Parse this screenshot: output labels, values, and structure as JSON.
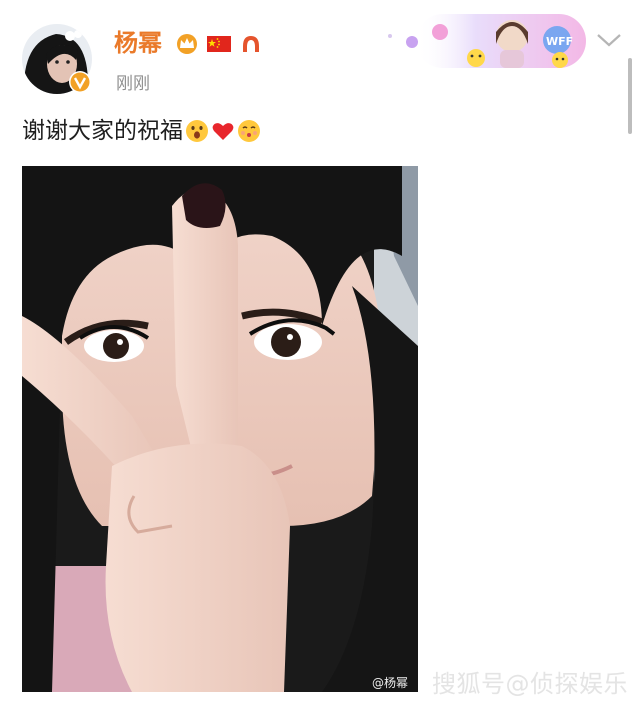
{
  "post": {
    "author": "杨幂",
    "time": "刚刚",
    "text": "谢谢大家的祝福",
    "badges": [
      "crown-icon",
      "china-flag-icon",
      "horseshoe-badge-icon"
    ],
    "verified": true
  },
  "decor_card": {
    "label": "WFF"
  },
  "image": {
    "watermark": "@杨幂"
  },
  "page_watermark": "搜狐号@侦探娱乐",
  "colors": {
    "username": "#ea7a2a",
    "verified": "#f2a126",
    "text": "#1f1f1f",
    "time": "#8f8f8f"
  }
}
